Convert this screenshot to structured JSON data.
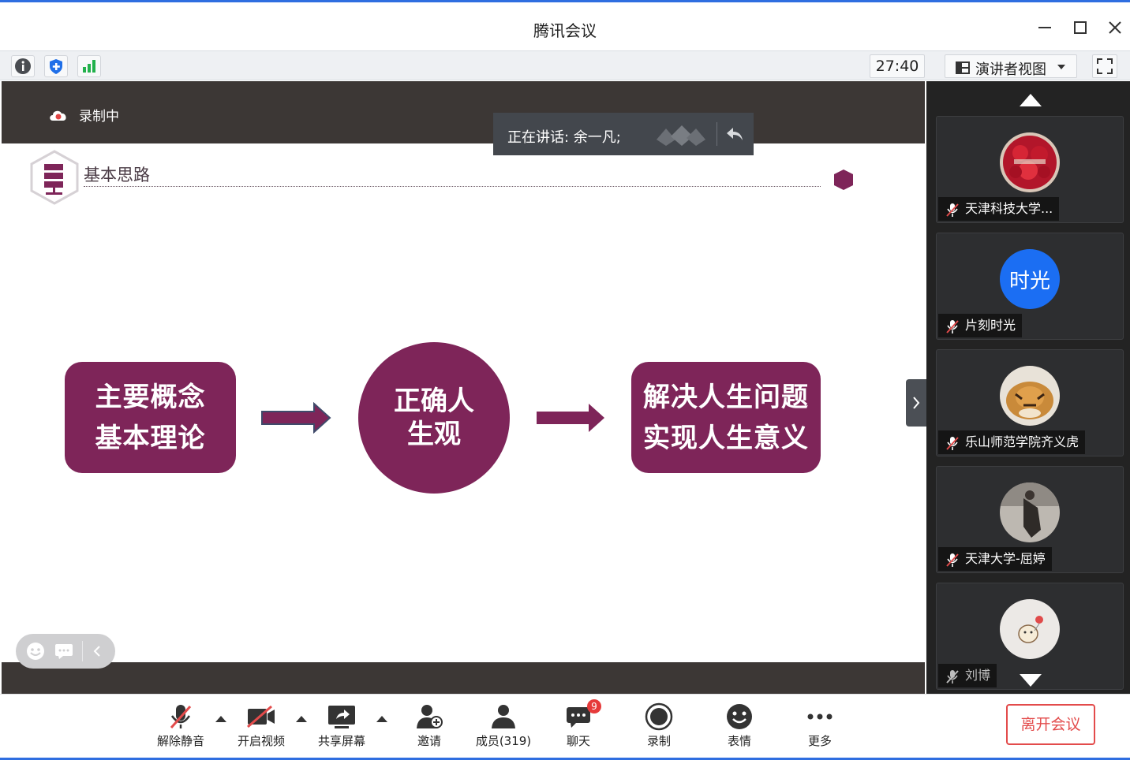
{
  "window": {
    "title": "腾讯会议"
  },
  "toolbar": {
    "timer": "27:40",
    "view_selector": "演讲者视图"
  },
  "share": {
    "recording_label": "录制中",
    "speaking": "正在讲话: 余一凡;"
  },
  "slide": {
    "title": "基本思路",
    "box_left": {
      "line1": "主要概念",
      "line2": "基本理论"
    },
    "circle": {
      "line1": "正确人",
      "line2": "生观"
    },
    "box_right": {
      "line1": "解决人生问题",
      "line2": "实现人生意义"
    },
    "accent": "#7e2559"
  },
  "participants": [
    {
      "name": "天津科技大学...",
      "avatar": "rose-photo"
    },
    {
      "name": "片刻时光",
      "avatar_text": "时光"
    },
    {
      "name": "乐山师范学院齐义虎",
      "avatar": "tiger-photo"
    },
    {
      "name": "天津大学-屈婷",
      "avatar": "photo"
    },
    {
      "name": "刘博",
      "avatar": "cartoon-cat"
    }
  ],
  "controls": {
    "unmute": "解除静音",
    "video": "开启视频",
    "share_screen": "共享屏幕",
    "invite": "邀请",
    "members": "成员(319)",
    "chat": "聊天",
    "chat_badge": "9",
    "record": "录制",
    "reaction": "表情",
    "more": "更多",
    "leave": "离开会议"
  },
  "colors": {
    "brand_blue": "#2f6ee0",
    "leave_red": "#e34b4b",
    "avatar_blue": "#1b6ef3"
  }
}
